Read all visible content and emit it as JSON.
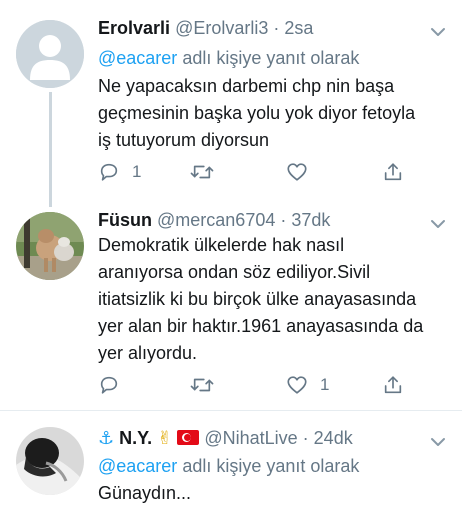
{
  "tweets": [
    {
      "name": "Erolvarli",
      "handle": "@Erolvarli3",
      "time": "2sa",
      "reply_prefix": "@eacarer",
      "reply_suffix": "adlı kişiye yanıt olarak",
      "text_lines": [
        "Ne yapacaksın darbemi chp nin başa",
        "geçmesinin başka yolu yok diyor fetoyla",
        "iş tutuyorum diyorsun"
      ],
      "reply_count": "1",
      "retweet_count": "",
      "like_count": ""
    },
    {
      "name": "Füsun",
      "handle": "@mercan6704",
      "time": "37dk",
      "text_lines": [
        "Demokratik ülkelerde hak nasıl",
        "aranıyorsa ondan söz ediliyor.Sivil",
        "itiatsizlik ki bu birçok ülke anayasasında",
        "yer alan bir haktır.1961 anayasasında da",
        "yer alıyordu."
      ],
      "reply_count": "",
      "retweet_count": "",
      "like_count": "1"
    },
    {
      "name": "N.Y.",
      "name_prefix_glyph": "⚓",
      "name_suffix_glyph": "✌",
      "handle": "@NihatLive",
      "time": "24dk",
      "reply_prefix": "@eacarer",
      "reply_suffix": "adlı kişiye yanıt olarak",
      "text_lines": [
        "Günaydın..."
      ]
    }
  ],
  "separator": "·",
  "colors": {
    "link": "#1da1f2",
    "muted": "#657786",
    "text": "#14171a",
    "thread_line": "#ccd6dd",
    "divider": "#e6ecf0"
  },
  "icons": [
    "chevron-down-icon",
    "reply-icon",
    "retweet-icon",
    "like-icon",
    "share-icon",
    "anchor-icon",
    "victory-hand-icon",
    "turkey-flag-icon"
  ]
}
